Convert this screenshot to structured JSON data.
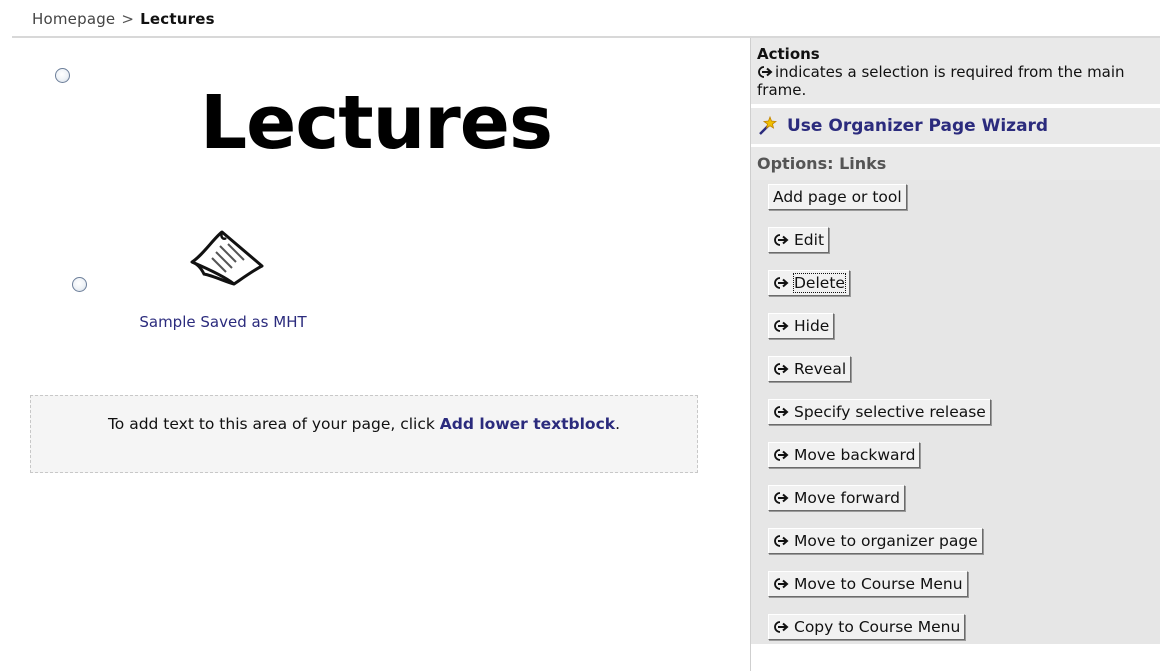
{
  "breadcrumb": {
    "home": "Homepage",
    "separator": ">",
    "current": "Lectures"
  },
  "page": {
    "title": "Lectures",
    "item_link": "Sample Saved as MHT",
    "item_icon": "document-icon",
    "textblock": {
      "prefix": "To add text to this area of your page, click ",
      "link": "Add lower textblock",
      "suffix": "."
    }
  },
  "actions": {
    "title": "Actions",
    "note": "indicates a selection is required from the main frame.",
    "note_icon": "selection-required-icon",
    "wizard_label": "Use Organizer Page Wizard",
    "wizard_icon": "magic-wand-icon",
    "options_title": "Options: Links",
    "buttons": [
      {
        "label": "Add page or tool",
        "requires_selection": false
      },
      {
        "label": "Edit",
        "requires_selection": true
      },
      {
        "label": "Delete",
        "requires_selection": true,
        "focused": true
      },
      {
        "label": "Hide",
        "requires_selection": true
      },
      {
        "label": "Reveal",
        "requires_selection": true
      },
      {
        "label": "Specify selective release",
        "requires_selection": true
      },
      {
        "label": "Move backward",
        "requires_selection": true
      },
      {
        "label": "Move forward",
        "requires_selection": true
      },
      {
        "label": "Move to organizer page",
        "requires_selection": true
      },
      {
        "label": "Move to Course Menu",
        "requires_selection": true
      },
      {
        "label": "Copy to Course Menu",
        "requires_selection": true
      }
    ]
  },
  "colors": {
    "link": "#2b2b7d",
    "panel_bg": "#e9e9e9",
    "textblock_bg": "#f5f5f5"
  }
}
